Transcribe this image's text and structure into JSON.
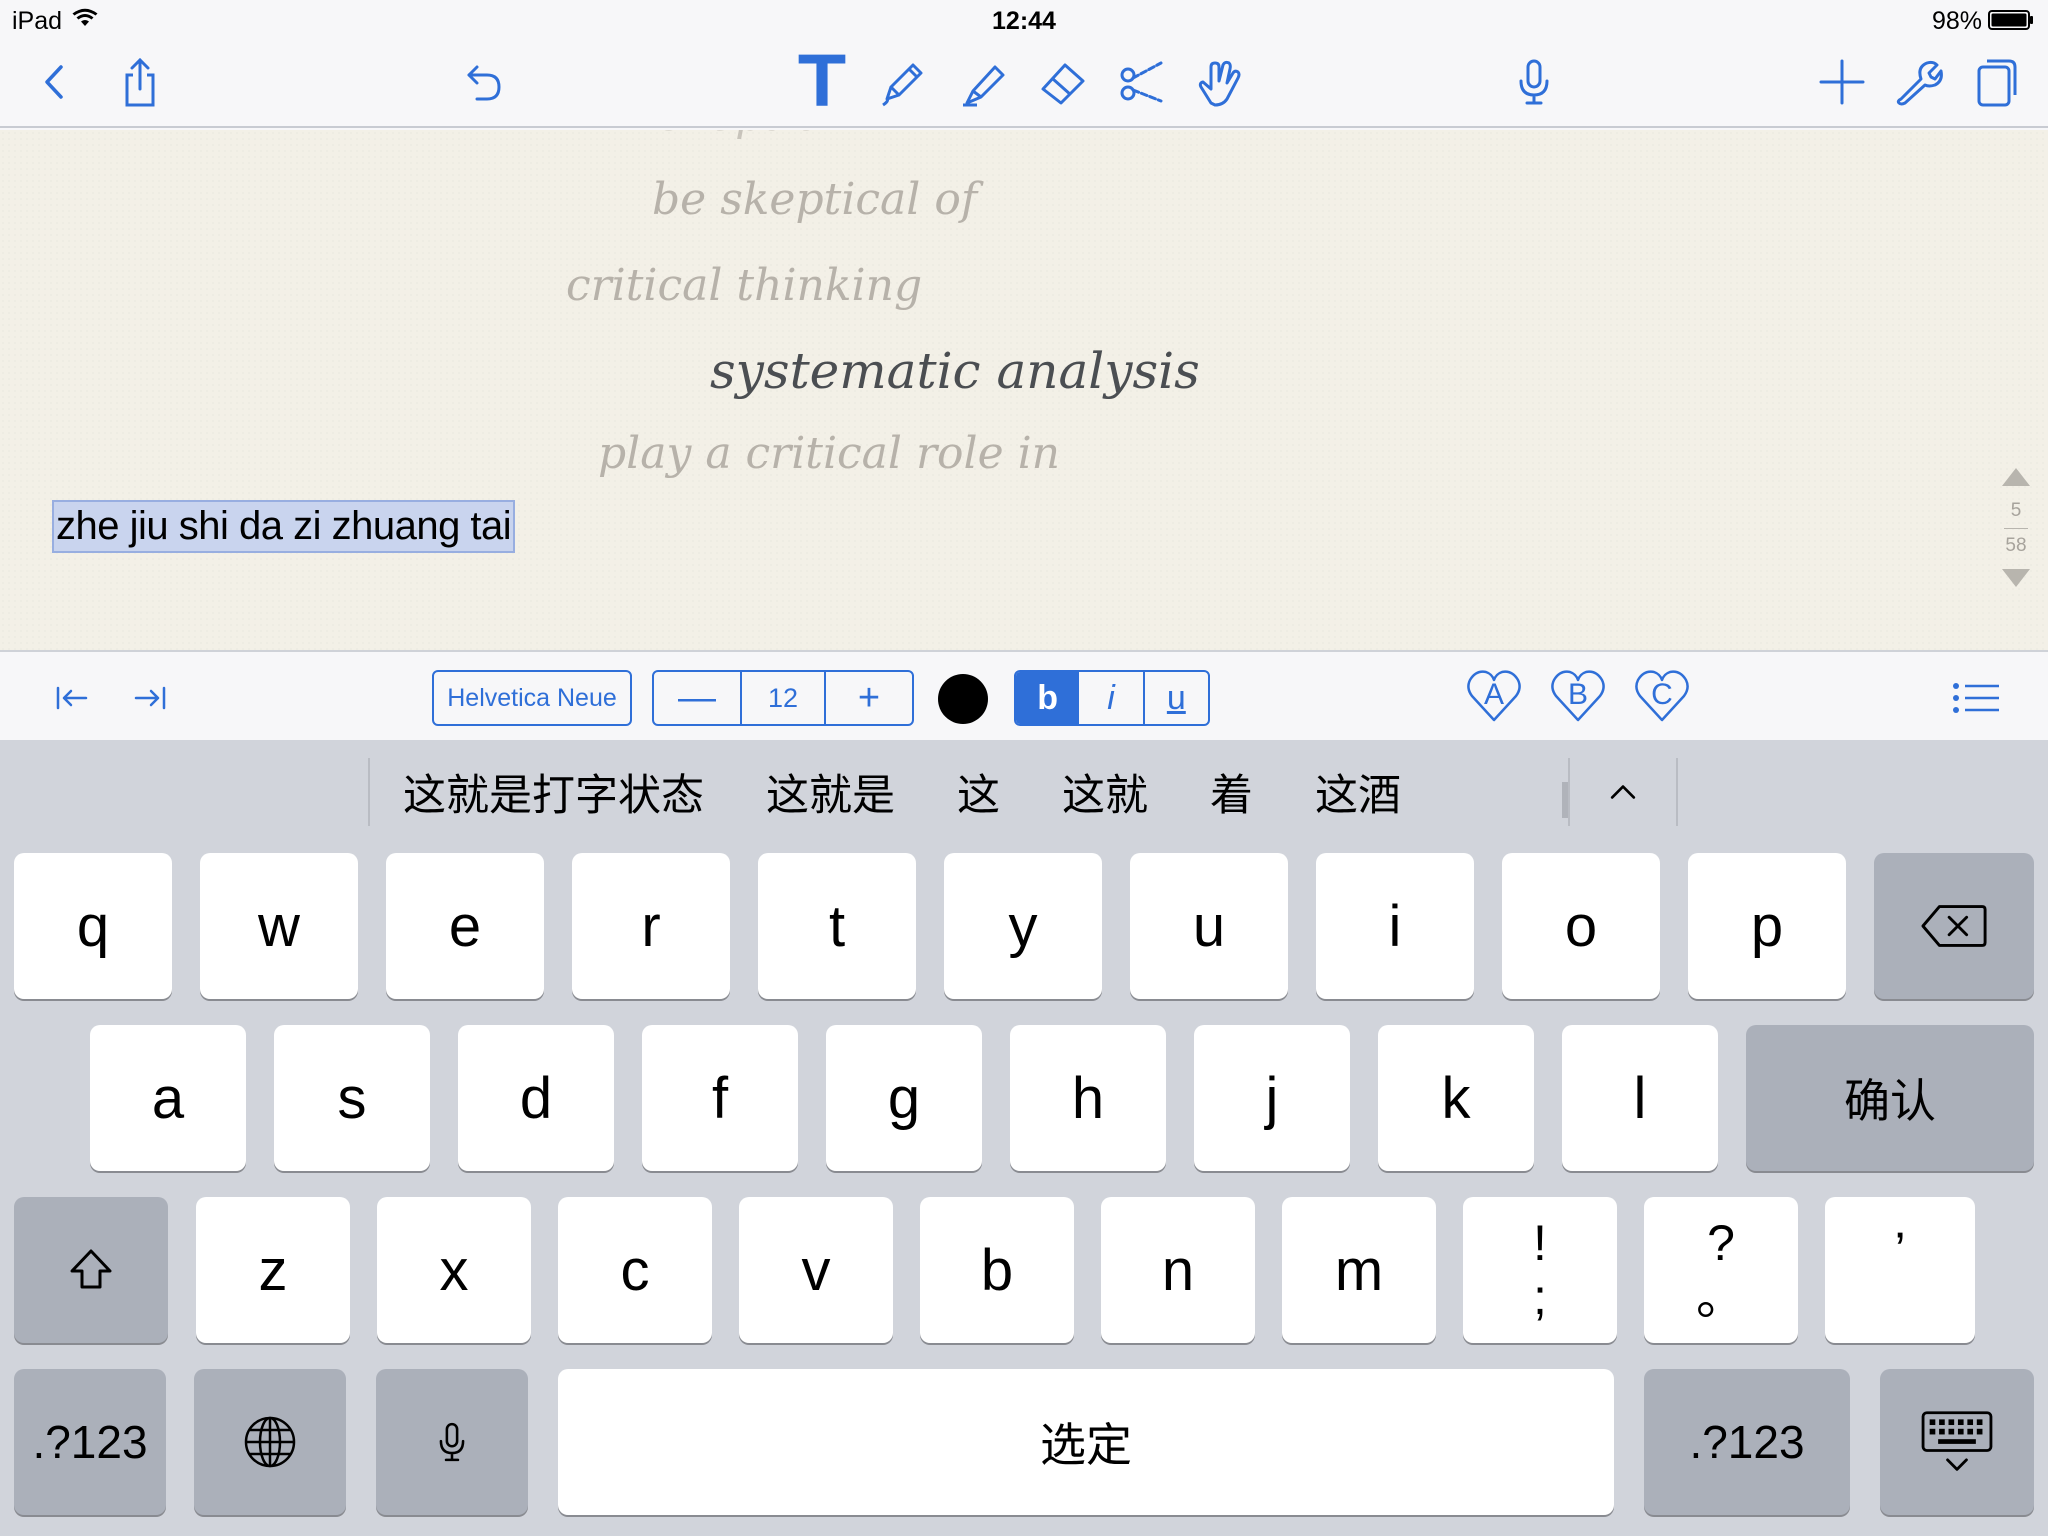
{
  "status_bar": {
    "device": "iPad",
    "time": "12:44",
    "battery": "98%"
  },
  "toolbar": {
    "left": [
      "back-icon",
      "share-icon",
      "undo-icon"
    ],
    "tools": [
      "text-tool-icon",
      "pen-icon",
      "highlighter-icon",
      "eraser-icon",
      "scissors-icon",
      "hand-icon"
    ],
    "center": [
      "microphone-icon"
    ],
    "right": [
      "add-icon",
      "wrench-icon",
      "pages-icon"
    ],
    "accent": "#2f6fd8"
  },
  "canvas": {
    "handwriting": [
      "be skeptical of",
      "critical thinking",
      "systematic analysis",
      "play a critical role in"
    ],
    "typed_text": "zhe jiu shi da zi zhuang tai",
    "page_current": "5",
    "page_total": "58"
  },
  "format_bar": {
    "font_name": "Helvetica Neue",
    "font_size": "12",
    "text_color": "#000000",
    "bold": "b",
    "italic": "i",
    "underline": "u",
    "favorites": [
      "A",
      "B",
      "C"
    ]
  },
  "keyboard": {
    "candidates": [
      "这就是打字状态",
      "这就是",
      "这",
      "这就",
      "着",
      "这酒"
    ],
    "row1": [
      "q",
      "w",
      "e",
      "r",
      "t",
      "y",
      "u",
      "i",
      "o",
      "p"
    ],
    "row2": [
      "a",
      "s",
      "d",
      "f",
      "g",
      "h",
      "j",
      "k",
      "l"
    ],
    "row3": [
      "z",
      "x",
      "c",
      "v",
      "b",
      "n",
      "m"
    ],
    "punct": [
      [
        "!",
        ";"
      ],
      [
        "?",
        "。"
      ],
      [
        "’",
        ""
      ]
    ],
    "confirm": "确认",
    "space": "选定",
    "numbers": ".?123"
  }
}
